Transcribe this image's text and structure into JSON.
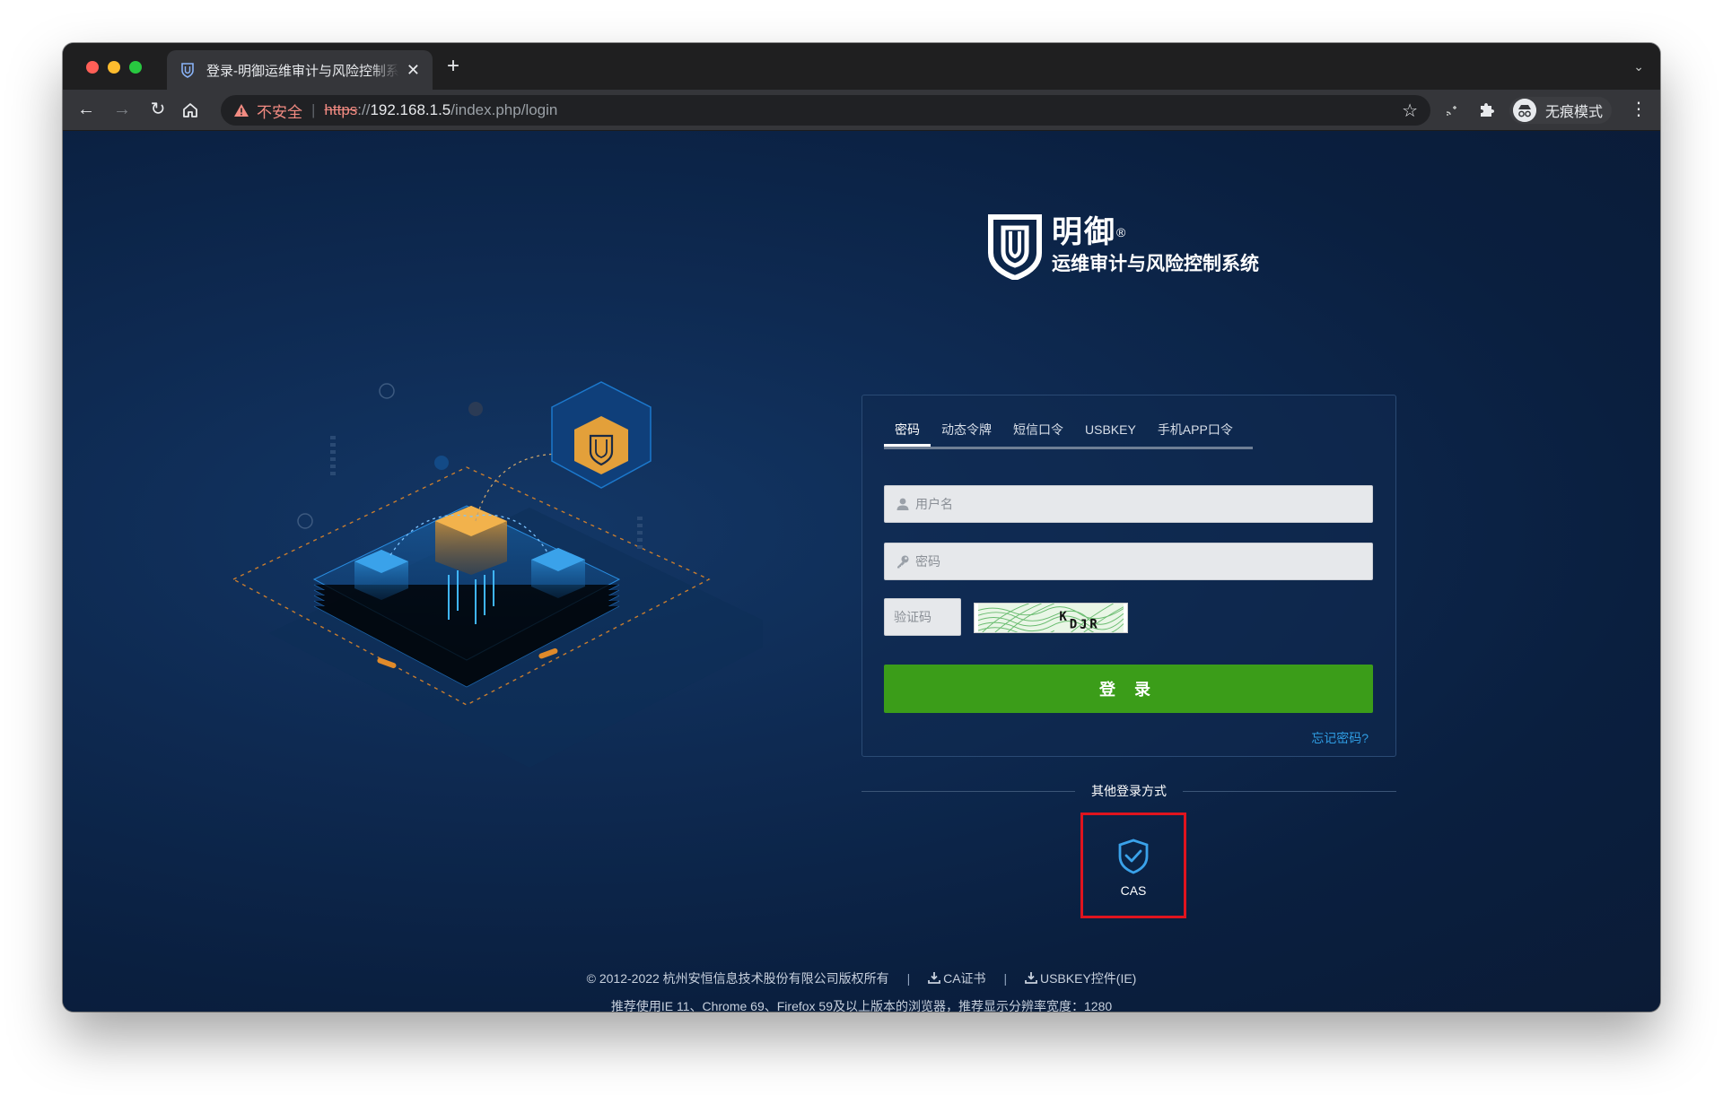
{
  "browser": {
    "tab_title": "登录-明御运维审计与风险控制系",
    "new_tab_label": "+",
    "address": {
      "security_label": "不安全",
      "scheme": "https",
      "scheme_sep": "://",
      "host": "192.168.1.5",
      "path": "/index.php/login"
    },
    "profile_label": "无痕模式"
  },
  "brand": {
    "name": "明御",
    "registered": "®",
    "subtitle": "运维审计与风险控制系统"
  },
  "login": {
    "tabs": [
      "密码",
      "动态令牌",
      "短信口令",
      "USBKEY",
      "手机APP口令"
    ],
    "active_tab": 0,
    "username_placeholder": "用户名",
    "password_placeholder": "密码",
    "captcha_placeholder": "验证码",
    "captcha_text": "KDJR",
    "submit_label": "登 录",
    "forgot_label": "忘记密码?"
  },
  "other_login": {
    "title": "其他登录方式",
    "methods": [
      {
        "label": "CAS",
        "icon": "shield-check-icon"
      }
    ]
  },
  "footer": {
    "copyright": "© 2012-2022 杭州安恒信息技术股份有限公司版权所有",
    "ca_cert": "CA证书",
    "usbkey": "USBKEY控件(IE)",
    "divider": "|",
    "recommend": "推荐使用IE 11、Chrome 69、Firefox 59及以上版本的浏览器，推荐显示分辨率宽度：1280"
  },
  "colors": {
    "page_bg": "#0e2a52",
    "login_button": "#3b9d19",
    "link": "#2f9de3",
    "highlight_box": "#e0141e"
  }
}
